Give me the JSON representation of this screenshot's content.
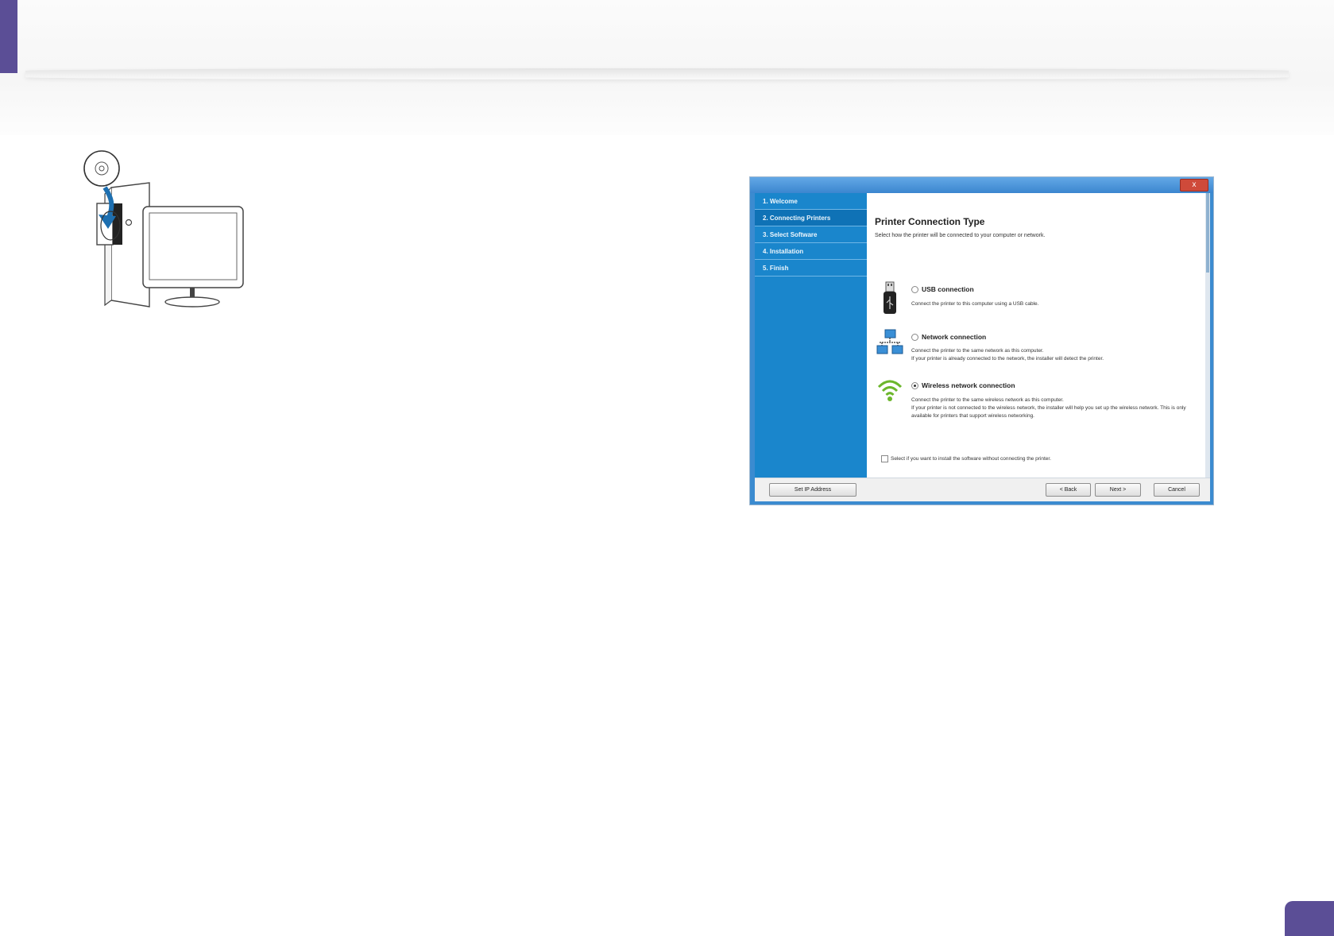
{
  "installer": {
    "close_label": "x",
    "steps": [
      {
        "label": "1. Welcome"
      },
      {
        "label": "2. Connecting Printers"
      },
      {
        "label": "3. Select Software"
      },
      {
        "label": "4. Installation"
      },
      {
        "label": "5. Finish"
      }
    ],
    "active_step": 2,
    "title": "Printer Connection Type",
    "subtitle": "Select how the printer will be connected to your computer or network.",
    "options": [
      {
        "label": "USB connection",
        "selected": false,
        "icon": "usb-icon",
        "desc_line1": "Connect the printer to this computer using a USB cable.",
        "desc_line2": ""
      },
      {
        "label": "Network connection",
        "selected": false,
        "icon": "network-icon",
        "desc_line1": "Connect the printer to the same network as this computer.",
        "desc_line2": "If your printer is already connected to the network, the installer will detect the printer."
      },
      {
        "label": "Wireless network connection",
        "selected": true,
        "icon": "wifi-icon",
        "desc_line1": "Connect the printer to the same wireless network as this computer.",
        "desc_line2": "If your printer is not connected to the wireless network, the installer will help you set up the wireless network. This is only available for printers that support wireless networking."
      }
    ],
    "skip_checkbox_label": "Select if you want to install the software without connecting the printer.",
    "skip_checked": false,
    "buttons": {
      "set_ip": "Set IP Address",
      "back": "< Back",
      "next": "Next >",
      "cancel": "Cancel"
    }
  },
  "colors": {
    "brand_purple": "#5b4e96",
    "sidebar_blue": "#1a86cc"
  }
}
